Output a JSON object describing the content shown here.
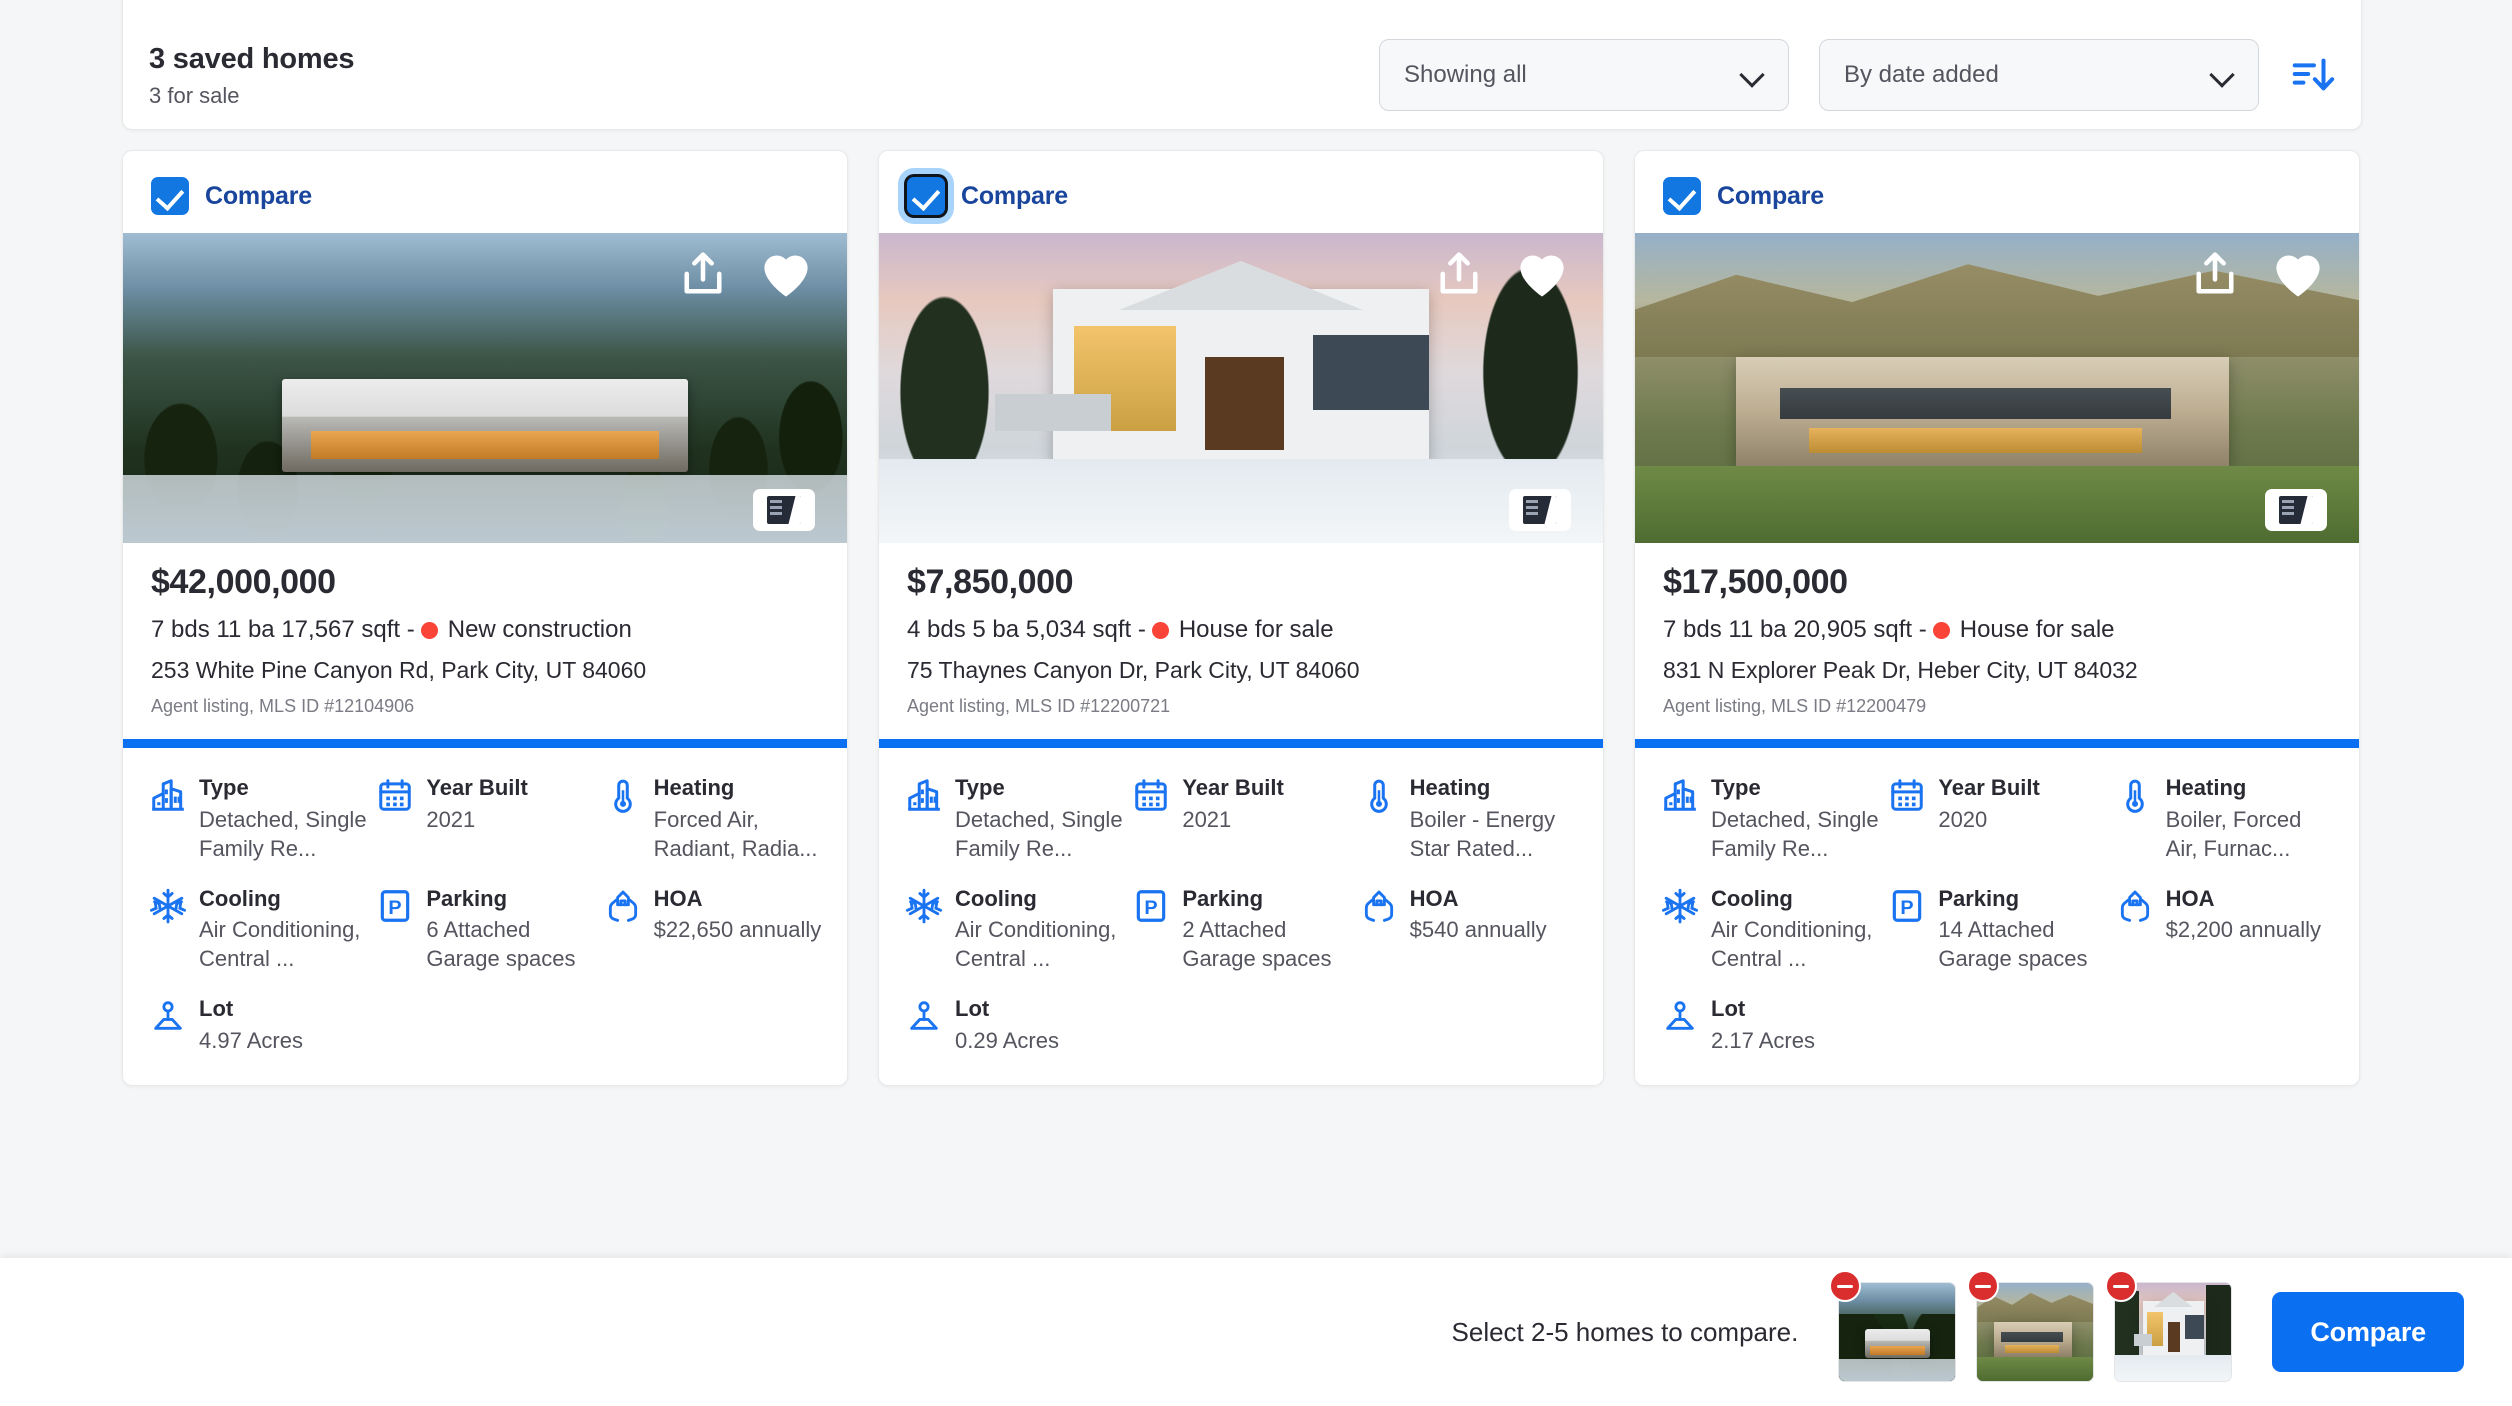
{
  "header": {
    "title": "3 saved homes",
    "subtitle": "3 for sale",
    "filter_select": {
      "value": "Showing all"
    },
    "sort_select": {
      "value": "By date added"
    },
    "sort_icon": "sort-descending-icon"
  },
  "compare_label": "Compare",
  "cards": [
    {
      "compare_checked": true,
      "compare_focused": false,
      "price": "$42,000,000",
      "beds_baths": "7 bds 11 ba 17,567 sqft -",
      "status": "New construction",
      "status_color": "#fa4438",
      "address": "253 White Pine Canyon Rd, Park City, UT 84060",
      "mls": "Agent listing, MLS ID #12104906",
      "facts": [
        {
          "icon": "building-icon",
          "label": "Type",
          "value": "Detached, Single Family Re..."
        },
        {
          "icon": "calendar-icon",
          "label": "Year Built",
          "value": "2021"
        },
        {
          "icon": "thermometer-icon",
          "label": "Heating",
          "value": "Forced Air, Radiant, Radia..."
        },
        {
          "icon": "snowflake-icon",
          "label": "Cooling",
          "value": "Air Conditioning, Central ..."
        },
        {
          "icon": "parking-icon",
          "label": "Parking",
          "value": "6 Attached Garage spaces"
        },
        {
          "icon": "hoa-hands-icon",
          "label": "HOA",
          "value": "$22,650 annually"
        },
        {
          "icon": "lot-icon",
          "label": "Lot",
          "value": "4.97 Acres"
        }
      ]
    },
    {
      "compare_checked": true,
      "compare_focused": true,
      "price": "$7,850,000",
      "beds_baths": "4 bds 5 ba 5,034 sqft -",
      "status": "House for sale",
      "status_color": "#fa4438",
      "address": "75 Thaynes Canyon Dr, Park City, UT 84060",
      "mls": "Agent listing, MLS ID #12200721",
      "facts": [
        {
          "icon": "building-icon",
          "label": "Type",
          "value": "Detached, Single Family Re..."
        },
        {
          "icon": "calendar-icon",
          "label": "Year Built",
          "value": "2021"
        },
        {
          "icon": "thermometer-icon",
          "label": "Heating",
          "value": "Boiler - Energy Star Rated..."
        },
        {
          "icon": "snowflake-icon",
          "label": "Cooling",
          "value": "Air Conditioning, Central ..."
        },
        {
          "icon": "parking-icon",
          "label": "Parking",
          "value": "2 Attached Garage spaces"
        },
        {
          "icon": "hoa-hands-icon",
          "label": "HOA",
          "value": "$540 annually"
        },
        {
          "icon": "lot-icon",
          "label": "Lot",
          "value": "0.29 Acres"
        }
      ]
    },
    {
      "compare_checked": true,
      "compare_focused": false,
      "price": "$17,500,000",
      "beds_baths": "7 bds 11 ba 20,905 sqft -",
      "status": "House for sale",
      "status_color": "#fa4438",
      "address": "831 N Explorer Peak Dr, Heber City, UT 84032",
      "mls": "Agent listing, MLS ID #12200479",
      "facts": [
        {
          "icon": "building-icon",
          "label": "Type",
          "value": "Detached, Single Family Re..."
        },
        {
          "icon": "calendar-icon",
          "label": "Year Built",
          "value": "2020"
        },
        {
          "icon": "thermometer-icon",
          "label": "Heating",
          "value": "Boiler, Forced Air, Furnac..."
        },
        {
          "icon": "snowflake-icon",
          "label": "Cooling",
          "value": "Air Conditioning, Central ..."
        },
        {
          "icon": "parking-icon",
          "label": "Parking",
          "value": "14 Attached Garage spaces"
        },
        {
          "icon": "hoa-hands-icon",
          "label": "HOA",
          "value": "$2,200 annually"
        },
        {
          "icon": "lot-icon",
          "label": "Lot",
          "value": "2.17 Acres"
        }
      ]
    }
  ],
  "bottom_bar": {
    "message": "Select 2-5 homes to compare.",
    "compare_button": "Compare",
    "thumbnails": [
      {
        "remove_icon": "remove-minus-icon"
      },
      {
        "remove_icon": "remove-minus-icon"
      },
      {
        "remove_icon": "remove-minus-icon"
      }
    ]
  },
  "colors": {
    "accent_blue": "#0a6ff0",
    "checkbox_blue": "#1277e1",
    "label_blue": "#19459c",
    "status_red": "#fa4438",
    "remove_red": "#da2e2e"
  }
}
